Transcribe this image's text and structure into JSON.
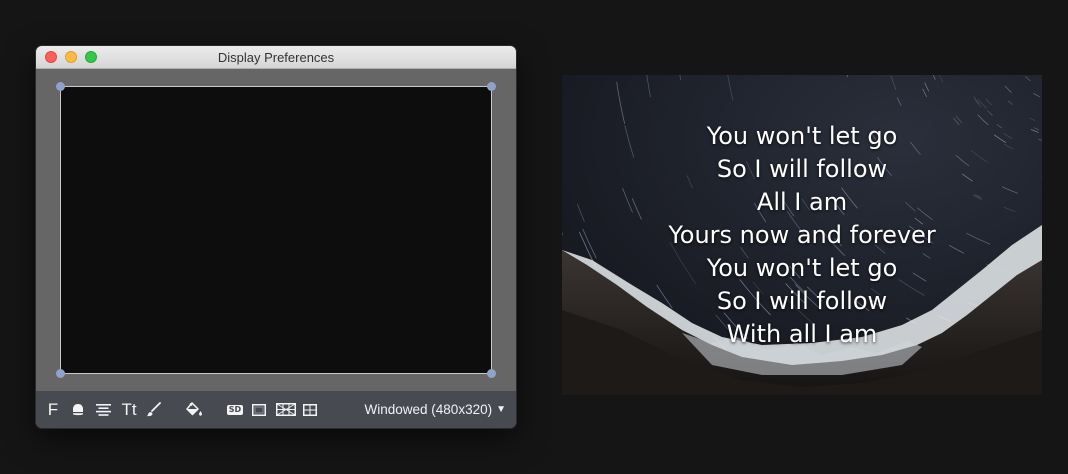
{
  "window": {
    "title": "Display Preferences",
    "buttons": {
      "close": "close",
      "minimize": "minimize",
      "zoom": "zoom"
    }
  },
  "toolbar": {
    "font_tool_label": "F",
    "text_size_label": "Tt",
    "sd_label": "SD",
    "resolution_label": "Windowed (480x320)",
    "icons": [
      "font-icon",
      "shape-icon",
      "align-center-icon",
      "text-size-icon",
      "brush-icon",
      "paint-bucket-icon",
      "sd-icon",
      "frame-icon",
      "grid-guide-icon",
      "crosshair-guide-icon",
      "chevron-down-icon"
    ]
  },
  "colors": {
    "window_bg": "#666666",
    "toolbar_bg": "#474a51",
    "handle": "#8fa3c8",
    "lyric_text": "#ffffff"
  },
  "output": {
    "lyrics": [
      "You won't let go",
      "So I will follow",
      "All I am",
      "Yours now and forever",
      "You won't let go",
      "So I will follow",
      "With all I am"
    ]
  }
}
